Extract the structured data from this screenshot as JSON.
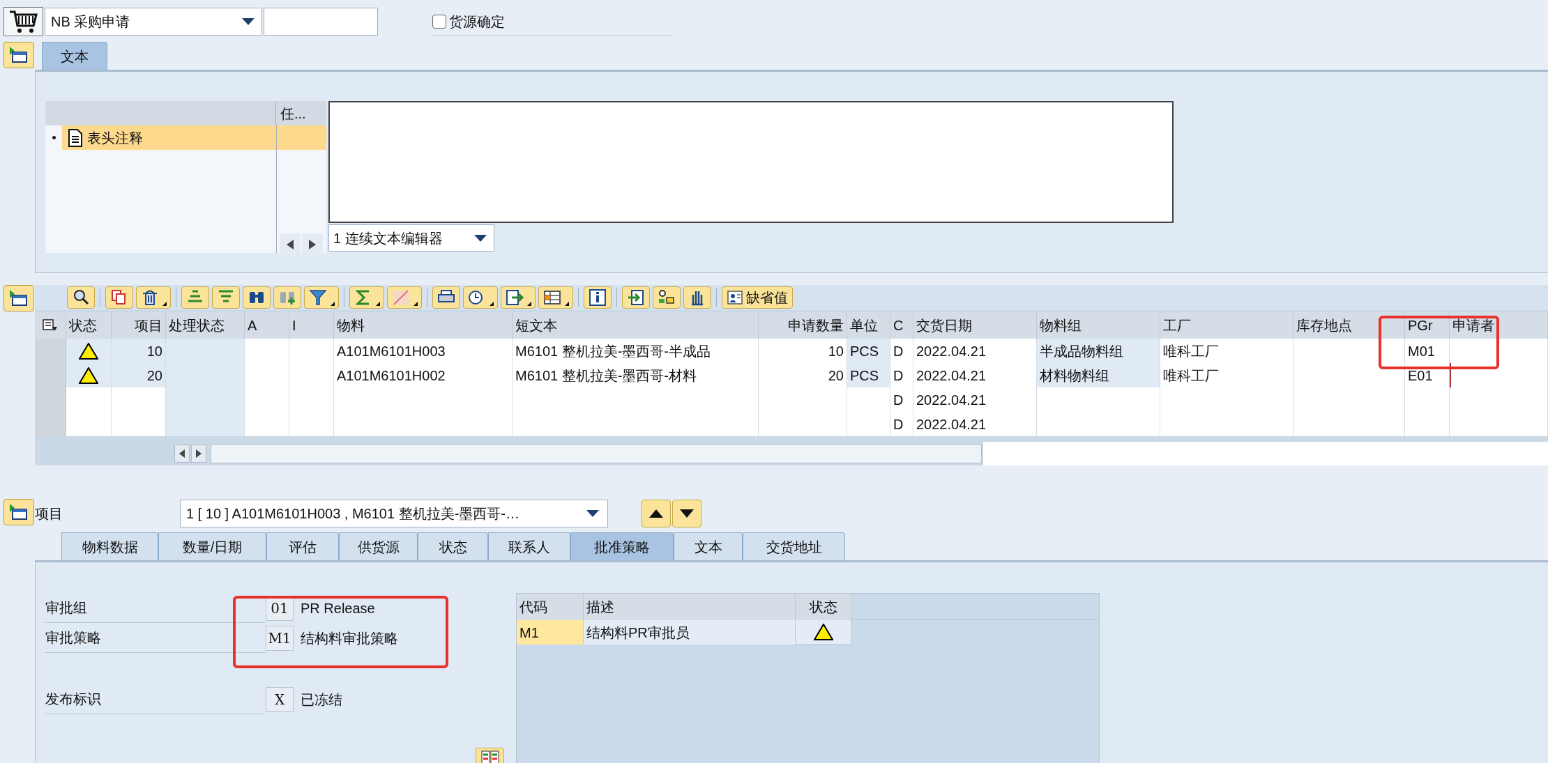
{
  "header": {
    "document_type": "NB 采购申请",
    "source_determination": {
      "label": "货源确定",
      "checked": false
    }
  },
  "header_tabs": [
    {
      "label": "文本",
      "selected": true
    }
  ],
  "text_tree": {
    "column_header": "任...",
    "items": [
      {
        "label": "表头注释",
        "selected": true
      }
    ]
  },
  "text_editor_selector": "1 连续文本编辑器",
  "toolbar": {
    "default_values_button": "缺省值"
  },
  "items_table": {
    "columns": [
      "状态",
      "项目",
      "处理状态",
      "A",
      "I",
      "物料",
      "短文本",
      "申请数量",
      "单位",
      "C",
      "交货日期",
      "物料组",
      "工厂",
      "库存地点",
      "PGr",
      "申请者"
    ],
    "rows": [
      {
        "warning": true,
        "item": "10",
        "material": "A101M6101H003",
        "short_text": "M6101 整机拉美-墨西哥-半成品",
        "quantity": "10",
        "unit": "PCS",
        "c": "D",
        "delivery_date": "2022.04.21",
        "material_group": "半成品物料组",
        "plant": "唯科工厂",
        "pgr": "M01",
        "requester_focused": false
      },
      {
        "warning": true,
        "item": "20",
        "material": "A101M6101H002",
        "short_text": "M6101 整机拉美-墨西哥-材料",
        "quantity": "20",
        "unit": "PCS",
        "c": "D",
        "delivery_date": "2022.04.21",
        "material_group": "材料物料组",
        "plant": "唯科工厂",
        "pgr": "E01",
        "requester_focused": true
      },
      {
        "warning": false,
        "c": "D",
        "delivery_date": "2022.04.21",
        "requester_focused": false
      },
      {
        "warning": false,
        "c": "D",
        "delivery_date": "2022.04.21",
        "requester_focused": false
      }
    ]
  },
  "item_selector": {
    "label": "项目",
    "value": "1 [ 10 ] A101M6101H003 , M6101 整机拉美-墨西哥-…"
  },
  "item_tabs": [
    {
      "label": "物料数据",
      "selected": false
    },
    {
      "label": "数量/日期",
      "selected": false
    },
    {
      "label": "评估",
      "selected": false
    },
    {
      "label": "供货源",
      "selected": false
    },
    {
      "label": "状态",
      "selected": false
    },
    {
      "label": "联系人",
      "selected": false
    },
    {
      "label": "批准策略",
      "selected": true
    },
    {
      "label": "文本",
      "selected": false
    },
    {
      "label": "交货地址",
      "selected": false
    }
  ],
  "release_fields": [
    {
      "label": "审批组",
      "code": "01",
      "description": "PR Release"
    },
    {
      "label": "审批策略",
      "code": "M1",
      "description": "结构料审批策略"
    },
    {
      "label": "发布标识",
      "code": "X",
      "description": "已冻结"
    }
  ],
  "release_table": {
    "columns": [
      "代码",
      "描述",
      "状态"
    ],
    "rows": [
      {
        "code": "M1",
        "description": "结构料PR审批员",
        "warning": true
      }
    ]
  }
}
